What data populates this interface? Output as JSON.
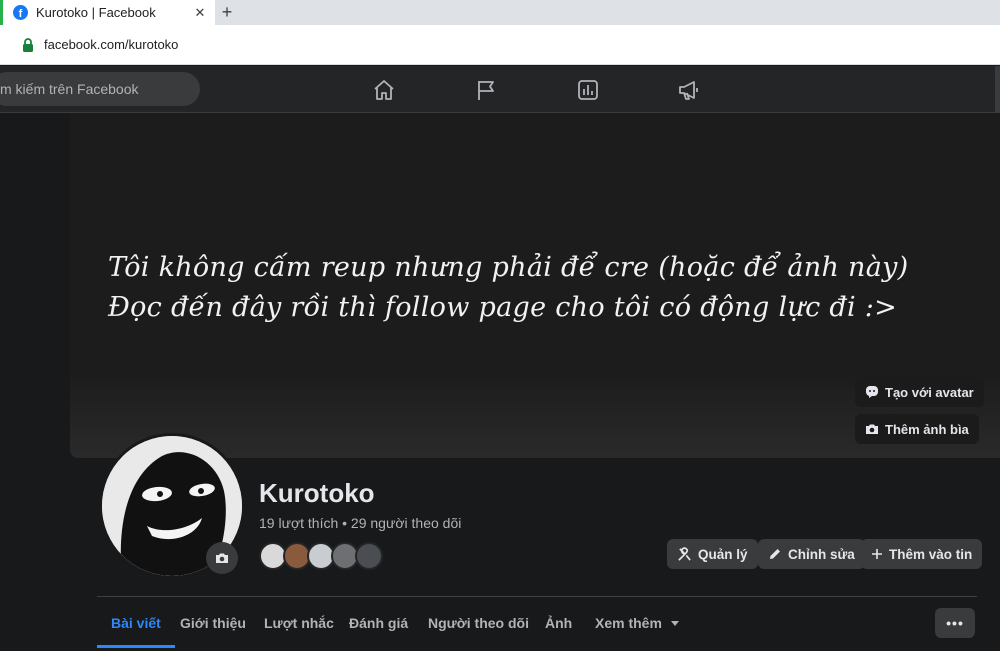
{
  "browser": {
    "tab_title": "Kurotoko | Facebook",
    "tab_close": "✕",
    "new_tab": "+",
    "url": "facebook.com/kurotoko"
  },
  "fbnav": {
    "search_placeholder": "m kiếm trên Facebook",
    "icons": [
      "home-icon",
      "flag-icon",
      "insights-icon",
      "megaphone-icon"
    ]
  },
  "cover": {
    "line1": "Tôi không cấm reup nhưng phải để cre (hoặc để ảnh này)",
    "line2": "Đọc đến đây rồi thì follow page cho tôi có động lực đi :>",
    "avatar_btn": "Tạo với avatar",
    "add_cover_btn": "Thêm ảnh bìa"
  },
  "profile": {
    "name": "Kurotoko",
    "stats": "19 lượt thích • 29 người theo dõi"
  },
  "actions": {
    "manage": "Quản lý",
    "edit": "Chỉnh sửa",
    "add_story": "Thêm vào tin"
  },
  "tabs": [
    "Bài viết",
    "Giới thiệu",
    "Lượt nhắc",
    "Đánh giá",
    "Người theo dõi",
    "Ảnh",
    "Xem thêm"
  ],
  "more_dots": "•••",
  "colors": {
    "accent": "#2d88ff",
    "background": "#18191a",
    "surface": "#242526",
    "button": "#3a3b3c"
  }
}
